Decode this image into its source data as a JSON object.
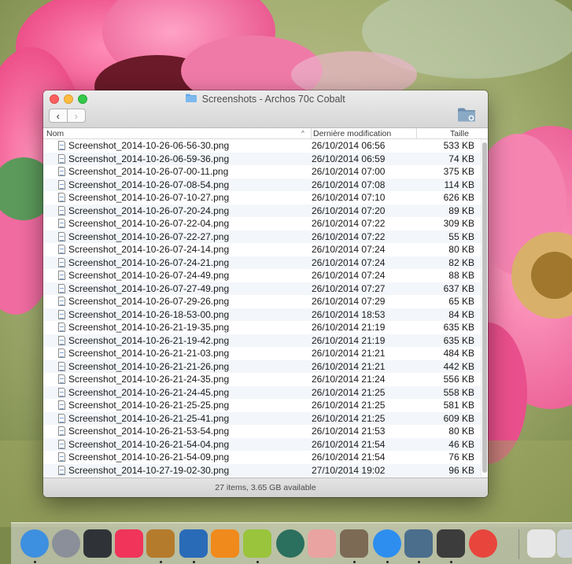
{
  "window": {
    "title": "Screenshots - Archos 70c Cobalt"
  },
  "toolbar": {
    "back_icon": "‹",
    "forward_icon": "›",
    "back_label": "chevron-left-icon",
    "forward_label": "chevron-right-icon",
    "new_folder_icon": "folder-add-icon"
  },
  "columns": {
    "name": "Nom",
    "date": "Dernière modification",
    "size": "Taille",
    "sort_indicator": "^"
  },
  "files": [
    {
      "name": "Screenshot_2014-10-26-06-56-30.png",
      "date": "26/10/2014 06:56",
      "size": "533 KB"
    },
    {
      "name": "Screenshot_2014-10-26-06-59-36.png",
      "date": "26/10/2014 06:59",
      "size": "74 KB"
    },
    {
      "name": "Screenshot_2014-10-26-07-00-11.png",
      "date": "26/10/2014 07:00",
      "size": "375 KB"
    },
    {
      "name": "Screenshot_2014-10-26-07-08-54.png",
      "date": "26/10/2014 07:08",
      "size": "114 KB"
    },
    {
      "name": "Screenshot_2014-10-26-07-10-27.png",
      "date": "26/10/2014 07:10",
      "size": "626 KB"
    },
    {
      "name": "Screenshot_2014-10-26-07-20-24.png",
      "date": "26/10/2014 07:20",
      "size": "89 KB"
    },
    {
      "name": "Screenshot_2014-10-26-07-22-04.png",
      "date": "26/10/2014 07:22",
      "size": "309 KB"
    },
    {
      "name": "Screenshot_2014-10-26-07-22-27.png",
      "date": "26/10/2014 07:22",
      "size": "55 KB"
    },
    {
      "name": "Screenshot_2014-10-26-07-24-14.png",
      "date": "26/10/2014 07:24",
      "size": "80 KB"
    },
    {
      "name": "Screenshot_2014-10-26-07-24-21.png",
      "date": "26/10/2014 07:24",
      "size": "82 KB"
    },
    {
      "name": "Screenshot_2014-10-26-07-24-49.png",
      "date": "26/10/2014 07:24",
      "size": "88 KB"
    },
    {
      "name": "Screenshot_2014-10-26-07-27-49.png",
      "date": "26/10/2014 07:27",
      "size": "637 KB"
    },
    {
      "name": "Screenshot_2014-10-26-07-29-26.png",
      "date": "26/10/2014 07:29",
      "size": "65 KB"
    },
    {
      "name": "Screenshot_2014-10-26-18-53-00.png",
      "date": "26/10/2014 18:53",
      "size": "84 KB"
    },
    {
      "name": "Screenshot_2014-10-26-21-19-35.png",
      "date": "26/10/2014 21:19",
      "size": "635 KB"
    },
    {
      "name": "Screenshot_2014-10-26-21-19-42.png",
      "date": "26/10/2014 21:19",
      "size": "635 KB"
    },
    {
      "name": "Screenshot_2014-10-26-21-21-03.png",
      "date": "26/10/2014 21:21",
      "size": "484 KB"
    },
    {
      "name": "Screenshot_2014-10-26-21-21-26.png",
      "date": "26/10/2014 21:21",
      "size": "442 KB"
    },
    {
      "name": "Screenshot_2014-10-26-21-24-35.png",
      "date": "26/10/2014 21:24",
      "size": "556 KB"
    },
    {
      "name": "Screenshot_2014-10-26-21-24-45.png",
      "date": "26/10/2014 21:25",
      "size": "558 KB"
    },
    {
      "name": "Screenshot_2014-10-26-21-25-25.png",
      "date": "26/10/2014 21:25",
      "size": "581 KB"
    },
    {
      "name": "Screenshot_2014-10-26-21-25-41.png",
      "date": "26/10/2014 21:25",
      "size": "609 KB"
    },
    {
      "name": "Screenshot_2014-10-26-21-53-54.png",
      "date": "26/10/2014 21:53",
      "size": "80 KB"
    },
    {
      "name": "Screenshot_2014-10-26-21-54-04.png",
      "date": "26/10/2014 21:54",
      "size": "46 KB"
    },
    {
      "name": "Screenshot_2014-10-26-21-54-09.png",
      "date": "26/10/2014 21:54",
      "size": "76 KB"
    },
    {
      "name": "Screenshot_2014-10-27-19-02-30.png",
      "date": "27/10/2014 19:02",
      "size": "96 KB"
    }
  ],
  "status": {
    "text": "27 items, 3.65 GB available"
  },
  "dock": {
    "items": [
      {
        "name": "finder-icon",
        "color": "#3d8fe0",
        "running": true
      },
      {
        "name": "launchpad-icon",
        "color": "#8a8f99",
        "running": false
      },
      {
        "name": "mission-control-icon",
        "color": "#2f3338",
        "running": false
      },
      {
        "name": "itunes-icon",
        "color": "#f0345a",
        "running": false
      },
      {
        "name": "game-icon",
        "color": "#b57b2c",
        "running": true
      },
      {
        "name": "thunderbird-icon",
        "color": "#2a6bb8",
        "running": true
      },
      {
        "name": "vlc-icon",
        "color": "#f08a1c",
        "running": false
      },
      {
        "name": "android-file-transfer-icon",
        "color": "#9ac43c",
        "running": true
      },
      {
        "name": "time-machine-icon",
        "color": "#2b6f5e",
        "running": false
      },
      {
        "name": "ham-icon",
        "color": "#e9a3a0",
        "running": false
      },
      {
        "name": "gimp-icon",
        "color": "#7c6a55",
        "running": true
      },
      {
        "name": "safari-icon",
        "color": "#2d8ef0",
        "running": true
      },
      {
        "name": "image-capture-icon",
        "color": "#4a6e8c",
        "running": true
      },
      {
        "name": "screenshot-icon",
        "color": "#3c3c3c",
        "running": true
      },
      {
        "name": "chrome-icon",
        "color": "#e8453c",
        "running": false
      },
      {
        "name": "document-icon",
        "color": "#e6e6e6",
        "running": false
      },
      {
        "name": "trash-icon",
        "color": "#cfd4d8",
        "running": false
      }
    ]
  },
  "colors": {
    "accent_folder": "#62a8e8",
    "row_alt": "#f3f6fa"
  }
}
